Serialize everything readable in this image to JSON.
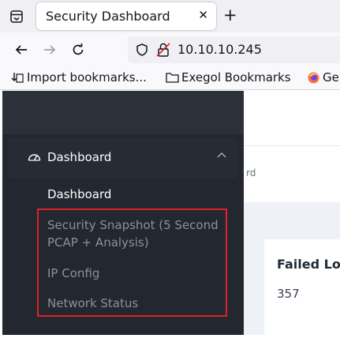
{
  "browser": {
    "tab_title": "Security Dashboard",
    "url": "10.10.10.245",
    "bookmarks": [
      {
        "label": "Import bookmarks..."
      },
      {
        "label": "Exegol Bookmarks"
      },
      {
        "label": "Ge"
      }
    ]
  },
  "sidebar": {
    "group": {
      "label": "Dashboard",
      "icon": "dashboard-gauge-icon",
      "expanded": true
    },
    "items": [
      {
        "label": "Dashboard",
        "active": true
      },
      {
        "label": "Security Snapshot (5 Second",
        "label_line2": "PCAP + Analysis)",
        "active": false
      },
      {
        "label": "IP Config",
        "active": false
      },
      {
        "label": "Network Status",
        "active": false
      }
    ]
  },
  "page": {
    "breadcrumb_fragment": "rd",
    "card": {
      "title": "Failed Log",
      "value": "357"
    }
  },
  "colors": {
    "sidebar_bg": "#23272f",
    "highlight": "#e0202a",
    "content_bg": "#eef1f6"
  }
}
